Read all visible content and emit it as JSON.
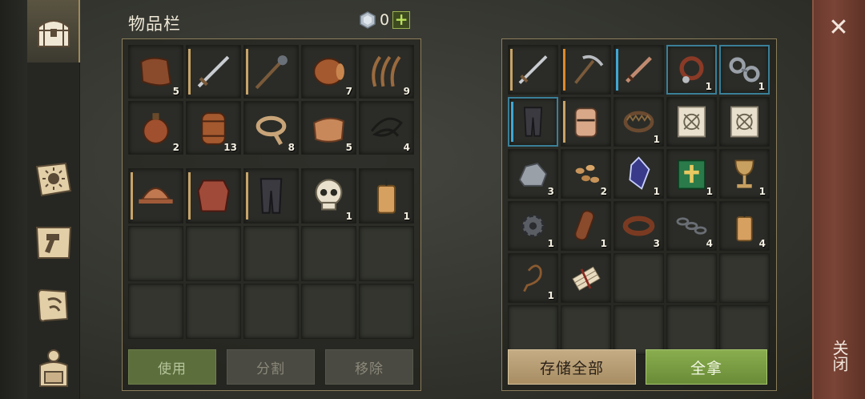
{
  "header": {
    "title": "物品栏",
    "currency_count": "0",
    "plus_label": "+"
  },
  "left_nav": [
    {
      "icon": "chest-icon",
      "active": true
    },
    {
      "icon": "sun-book-icon"
    },
    {
      "icon": "hammer-icon"
    },
    {
      "icon": "map-scroll-icon"
    },
    {
      "icon": "backpack-icon"
    }
  ],
  "inventory": {
    "top": [
      {
        "icon": "leather-scrap-icon",
        "qty": "5"
      },
      {
        "icon": "sword-icon",
        "qty": "",
        "durability": "tan"
      },
      {
        "icon": "mace-icon",
        "qty": "",
        "durability": "tan"
      },
      {
        "icon": "barrel-icon",
        "qty": "7"
      },
      {
        "icon": "fiber-icon",
        "qty": "9"
      },
      {
        "icon": "flask-icon",
        "qty": "2"
      },
      {
        "icon": "keg-icon",
        "qty": "13"
      },
      {
        "icon": "rope-icon",
        "qty": "8"
      },
      {
        "icon": "cloth-icon",
        "qty": "5"
      },
      {
        "icon": "cord-icon",
        "qty": "4"
      }
    ],
    "bottom": [
      {
        "icon": "helmet-icon",
        "qty": "",
        "durability": "tan"
      },
      {
        "icon": "chainmail-icon",
        "qty": "",
        "durability": "tan"
      },
      {
        "icon": "leggings-icon",
        "qty": "",
        "durability": "tan"
      },
      {
        "icon": "skull-icon",
        "qty": "1"
      },
      {
        "icon": "candle-icon",
        "qty": "1"
      }
    ]
  },
  "container": {
    "rows": [
      [
        {
          "icon": "sword-icon",
          "qty": "",
          "durability": "tan"
        },
        {
          "icon": "pickaxe-icon",
          "qty": "",
          "durability": "orange"
        },
        {
          "icon": "dagger-icon",
          "qty": "",
          "durability": "blue"
        },
        {
          "icon": "collar-icon",
          "qty": "1",
          "frame": "blue"
        },
        {
          "icon": "shackles-icon",
          "qty": "1",
          "frame": "blue"
        }
      ],
      [
        {
          "icon": "leggings-icon",
          "qty": "",
          "durability": "blue",
          "frame": "blue"
        },
        {
          "icon": "great-helm-icon",
          "qty": "",
          "durability": "tan"
        },
        {
          "icon": "bear-trap-icon",
          "qty": "1"
        },
        {
          "icon": "blueprint-icon",
          "qty": ""
        },
        {
          "icon": "blueprint-icon",
          "qty": ""
        }
      ],
      [
        {
          "icon": "iron-ore-icon",
          "qty": "3"
        },
        {
          "icon": "seeds-icon",
          "qty": "2"
        },
        {
          "icon": "crystal-icon",
          "qty": "1"
        },
        {
          "icon": "holy-book-icon",
          "qty": "1"
        },
        {
          "icon": "chalice-icon",
          "qty": "1"
        }
      ],
      [
        {
          "icon": "gear-icon",
          "qty": "1"
        },
        {
          "icon": "leather-roll-icon",
          "qty": "1"
        },
        {
          "icon": "belt-icon",
          "qty": "3"
        },
        {
          "icon": "chain-icon",
          "qty": "4"
        },
        {
          "icon": "candle-icon",
          "qty": "4"
        }
      ],
      [
        {
          "icon": "whip-icon",
          "qty": "1"
        },
        {
          "icon": "scroll-bundle-icon",
          "qty": ""
        },
        {
          "icon": "",
          "qty": ""
        },
        {
          "icon": "",
          "qty": ""
        },
        {
          "icon": "",
          "qty": ""
        }
      ],
      [
        {
          "icon": "",
          "qty": ""
        },
        {
          "icon": "",
          "qty": ""
        },
        {
          "icon": "",
          "qty": ""
        },
        {
          "icon": "",
          "qty": ""
        },
        {
          "icon": "",
          "qty": ""
        }
      ]
    ]
  },
  "buttons": {
    "use": "使用",
    "split": "分割",
    "remove": "移除",
    "store_all": "存储全部",
    "take_all": "全拿"
  },
  "close": {
    "x": "✕",
    "label": "关闭"
  },
  "colors": {
    "accent_green": "#7fa244",
    "accent_tan": "#b89a6e",
    "close_red": "#7a4436",
    "rarity_blue": "#3a7f98"
  }
}
